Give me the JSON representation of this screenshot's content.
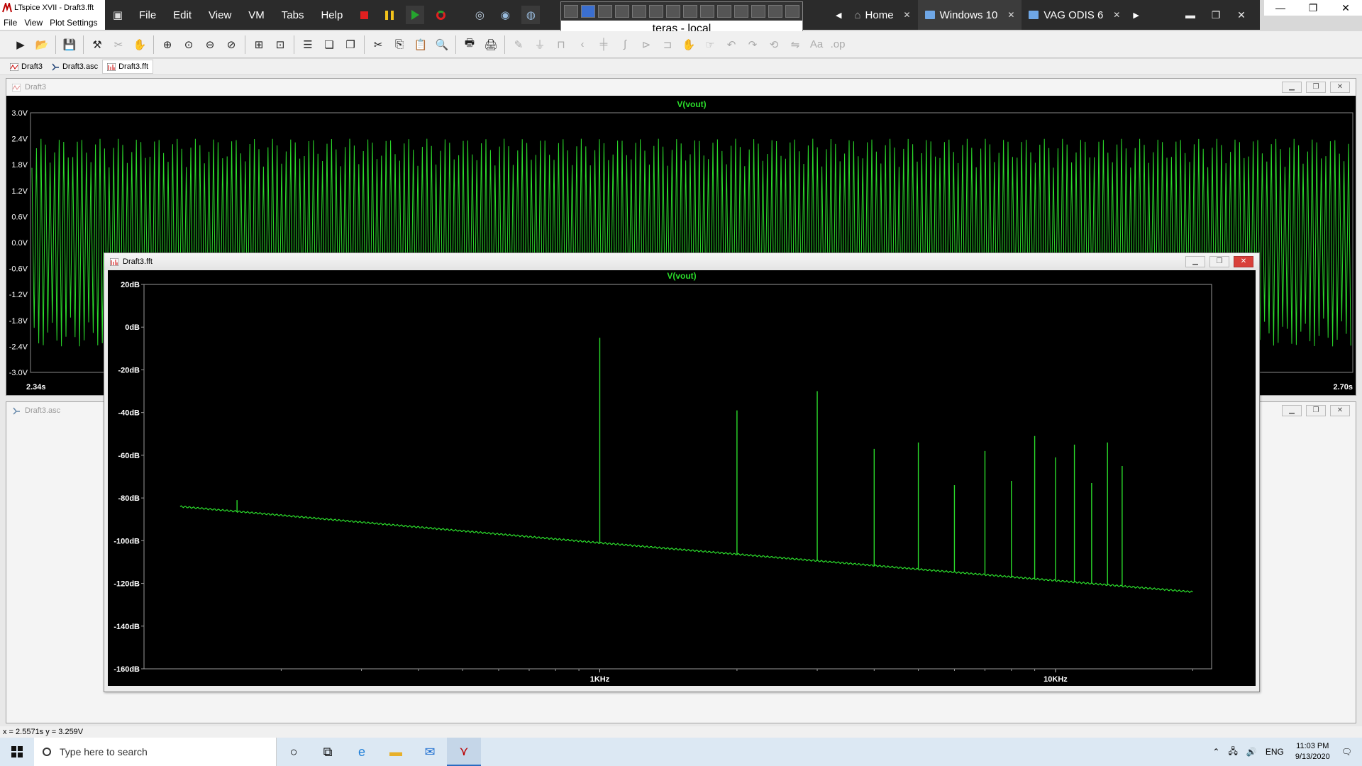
{
  "app": {
    "title": "LTspice XVII - Draft3.fft",
    "menu": [
      "File",
      "View",
      "Plot Settings"
    ]
  },
  "vm": {
    "menu": [
      "File",
      "Edit",
      "View",
      "VM",
      "Tabs",
      "Help"
    ],
    "tabs": [
      {
        "label": "Home"
      },
      {
        "label": "Windows 10"
      },
      {
        "label": "VAG ODIS 6"
      }
    ],
    "connection_title": "teras - local"
  },
  "doc_tabs": [
    "Draft3",
    "Draft3.asc",
    "Draft3.fft"
  ],
  "windows": {
    "transient_title": "Draft3",
    "schematic_title": "Draft3.asc",
    "fft_title": "Draft3.fft"
  },
  "chart_data": [
    {
      "type": "line",
      "title": "V(vout)",
      "ylim": [
        -3.0,
        3.0
      ],
      "y_ticks": [
        "3.0V",
        "2.4V",
        "1.8V",
        "1.2V",
        "0.6V",
        "0.0V",
        "-0.6V",
        "-1.2V",
        "-1.8V",
        "-2.4V",
        "-3.0V"
      ],
      "x_ticks": [
        "2.34s",
        "2.70s"
      ],
      "xlim": [
        2.34,
        2.7
      ],
      "series": [
        {
          "name": "V(vout)",
          "values_range": [
            -2.4,
            2.4
          ]
        }
      ],
      "color": "#2bdc2b"
    },
    {
      "type": "line",
      "title": "V(vout)",
      "xscale": "log",
      "ylim": [
        -160,
        20
      ],
      "y_ticks": [
        "20dB",
        "0dB",
        "-20dB",
        "-40dB",
        "-60dB",
        "-80dB",
        "-100dB",
        "-120dB",
        "-140dB",
        "-160dB"
      ],
      "x_ticks": [
        "1KHz",
        "10KHz"
      ],
      "noise_floor": [
        [
          120,
          -84
        ],
        [
          1000,
          -101
        ],
        [
          20000,
          -124
        ]
      ],
      "peaks": [
        {
          "x": 160,
          "y": -81
        },
        {
          "x": 1000,
          "y": -5
        },
        {
          "x": 2000,
          "y": -39
        },
        {
          "x": 3000,
          "y": -30
        },
        {
          "x": 4000,
          "y": -57
        },
        {
          "x": 5000,
          "y": -54
        },
        {
          "x": 6000,
          "y": -74
        },
        {
          "x": 7000,
          "y": -58
        },
        {
          "x": 8000,
          "y": -72
        },
        {
          "x": 9000,
          "y": -51
        },
        {
          "x": 10000,
          "y": -61
        },
        {
          "x": 11000,
          "y": -55
        },
        {
          "x": 12000,
          "y": -73
        },
        {
          "x": 13000,
          "y": -54
        },
        {
          "x": 14000,
          "y": -65
        }
      ],
      "color": "#2bdc2b"
    }
  ],
  "status_bar": {
    "readout": "x = 2.5571s    y = 3.259V"
  },
  "taskbar": {
    "search_placeholder": "Type here to search",
    "lang": "ENG",
    "time": "11:03 PM",
    "date": "9/13/2020"
  }
}
